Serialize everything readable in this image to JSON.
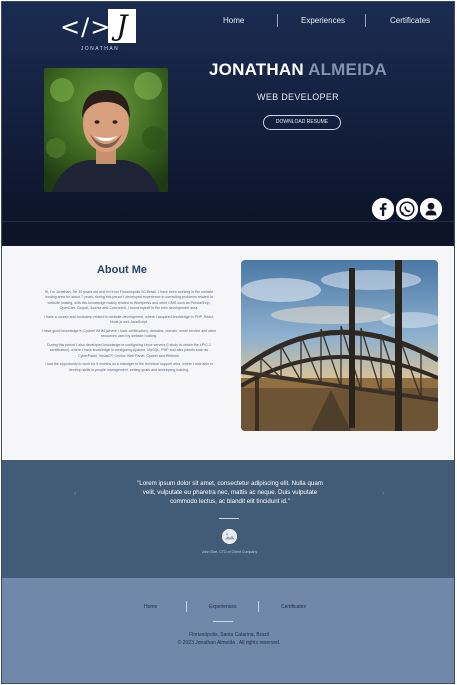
{
  "logo": {
    "code": "</>",
    "initial": "J",
    "name": "JONATHAN"
  },
  "nav": {
    "items": [
      "Home",
      "Experiences",
      "Certificates"
    ]
  },
  "hero": {
    "first_name": "JONATHAN",
    "last_name": "ALMEIDA",
    "role": "WEB DEVELOPER",
    "resume_button": "DOWNLOAD RESUME"
  },
  "social": [
    "facebook-icon",
    "whatsapp-icon",
    "user-icon"
  ],
  "about": {
    "title": "About Me",
    "paragraphs": [
      "Hi, I'm Jonathan, I'm 30 years old and I'm from Florianópolis SC Brazil. I have been working in the website hosting area for about 7 years, during this period I developed experience in correcting problems related to website hosting, with this knowledge mainly related to Wordpress and other CMS such as PrestaShop, OpenCart, Drupal, Joomla and Concrete5, I found myself in the web development area.",
      "I have a course and bootcamp related to website development, where I acquired knowledge in PHP, React, Node.js and JavaScript.",
      "I have good knowledge in Cpanel WHM (where I have certification), domains, domain, email service and other resources used by website hosting.",
      "During this period I also developed knowledge in configuring Linux servers (I study to obtain the LPIC-1 certification), where I have knowledge in configuring Apache, MySQL, PHP and also panels such as CyberPanel, VestaCP, Centos Web Panel, Cpanel and Webmin.",
      "I had the opportunity to work for 5 months as a manager in the technical support area, where I was able to develop skills in people management, setting goals and developing training."
    ]
  },
  "testimonial": {
    "quote": "\"Lorem ipsum dolor sit amet, consectetur adipiscing elit. Nulla quam velit, vulputate eu pharetra nec, mattis ac neque. Duis vulputate commodo lectus, ac blandit elit tincidunt id.\"",
    "author": "John Doe, CTO of Client Company",
    "prev": "‹",
    "next": "›"
  },
  "footer": {
    "nav": [
      "Home",
      "Experiences",
      "Certificates"
    ],
    "city": "Florianópolis, Santa Catarina, Brazil",
    "copyright": "© 2023 Jonathan Almeida . All rights reserved."
  },
  "colors": {
    "hero_dark": "#14203f",
    "accent_last_name": "#8593b3",
    "title_blue": "#2c4266",
    "testimonial_bg": "#425c78",
    "footer_bg": "#7188ab"
  }
}
